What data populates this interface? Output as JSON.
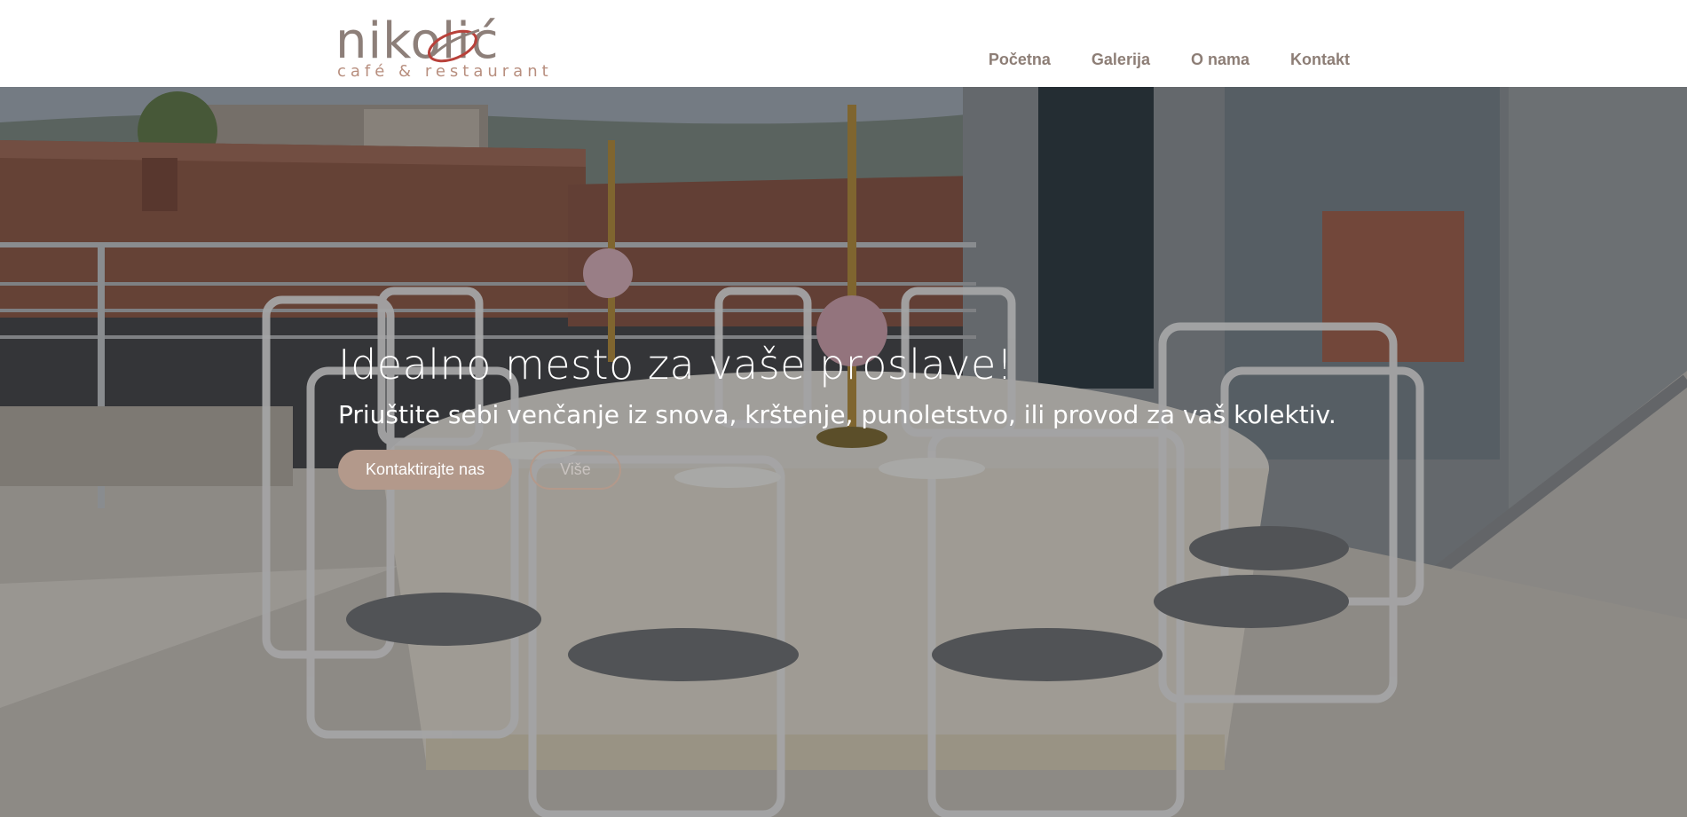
{
  "brand": {
    "name": "nikolić",
    "tagline": "café & restaurant",
    "colors": {
      "primary": "#8d7f79",
      "accent": "#b3998b"
    }
  },
  "nav": {
    "items": [
      {
        "label": "Početna"
      },
      {
        "label": "Galerija"
      },
      {
        "label": "O nama"
      },
      {
        "label": "Kontakt"
      }
    ]
  },
  "hero": {
    "title": "Idealno mesto za vaše proslave!",
    "subtitle": "Priuštite sebi venčanje iz snova, krštenje, punoletstvo, ili provod za vaš kolektiv.",
    "primary_button": "Kontaktirajte nas",
    "secondary_button": "Više",
    "overlay_color": "#232326"
  }
}
